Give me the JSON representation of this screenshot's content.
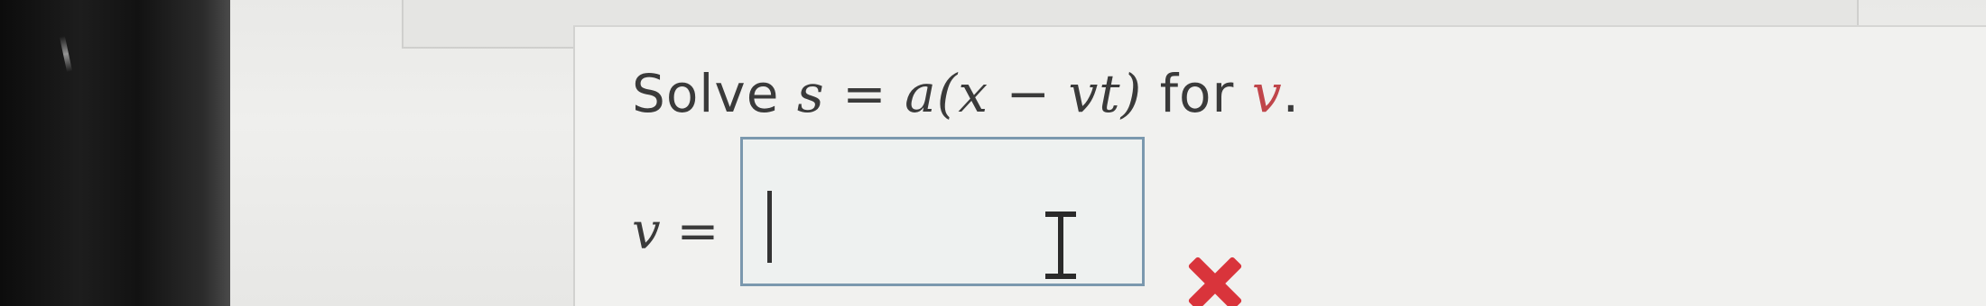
{
  "question": {
    "prefix": "Solve ",
    "equation": "s = a(x − vt)",
    "connector": " for ",
    "target_variable": "v",
    "suffix": "."
  },
  "answer": {
    "label_variable": "v",
    "label_equals": " =",
    "input_value": "",
    "status": "incorrect"
  },
  "colors": {
    "target_variable": "#c0454a",
    "input_border": "#7b98ae",
    "wrong_mark": "#d9343b"
  },
  "icons": {
    "cursor": "text-cursor-icon",
    "status": "wrong-x-icon"
  }
}
